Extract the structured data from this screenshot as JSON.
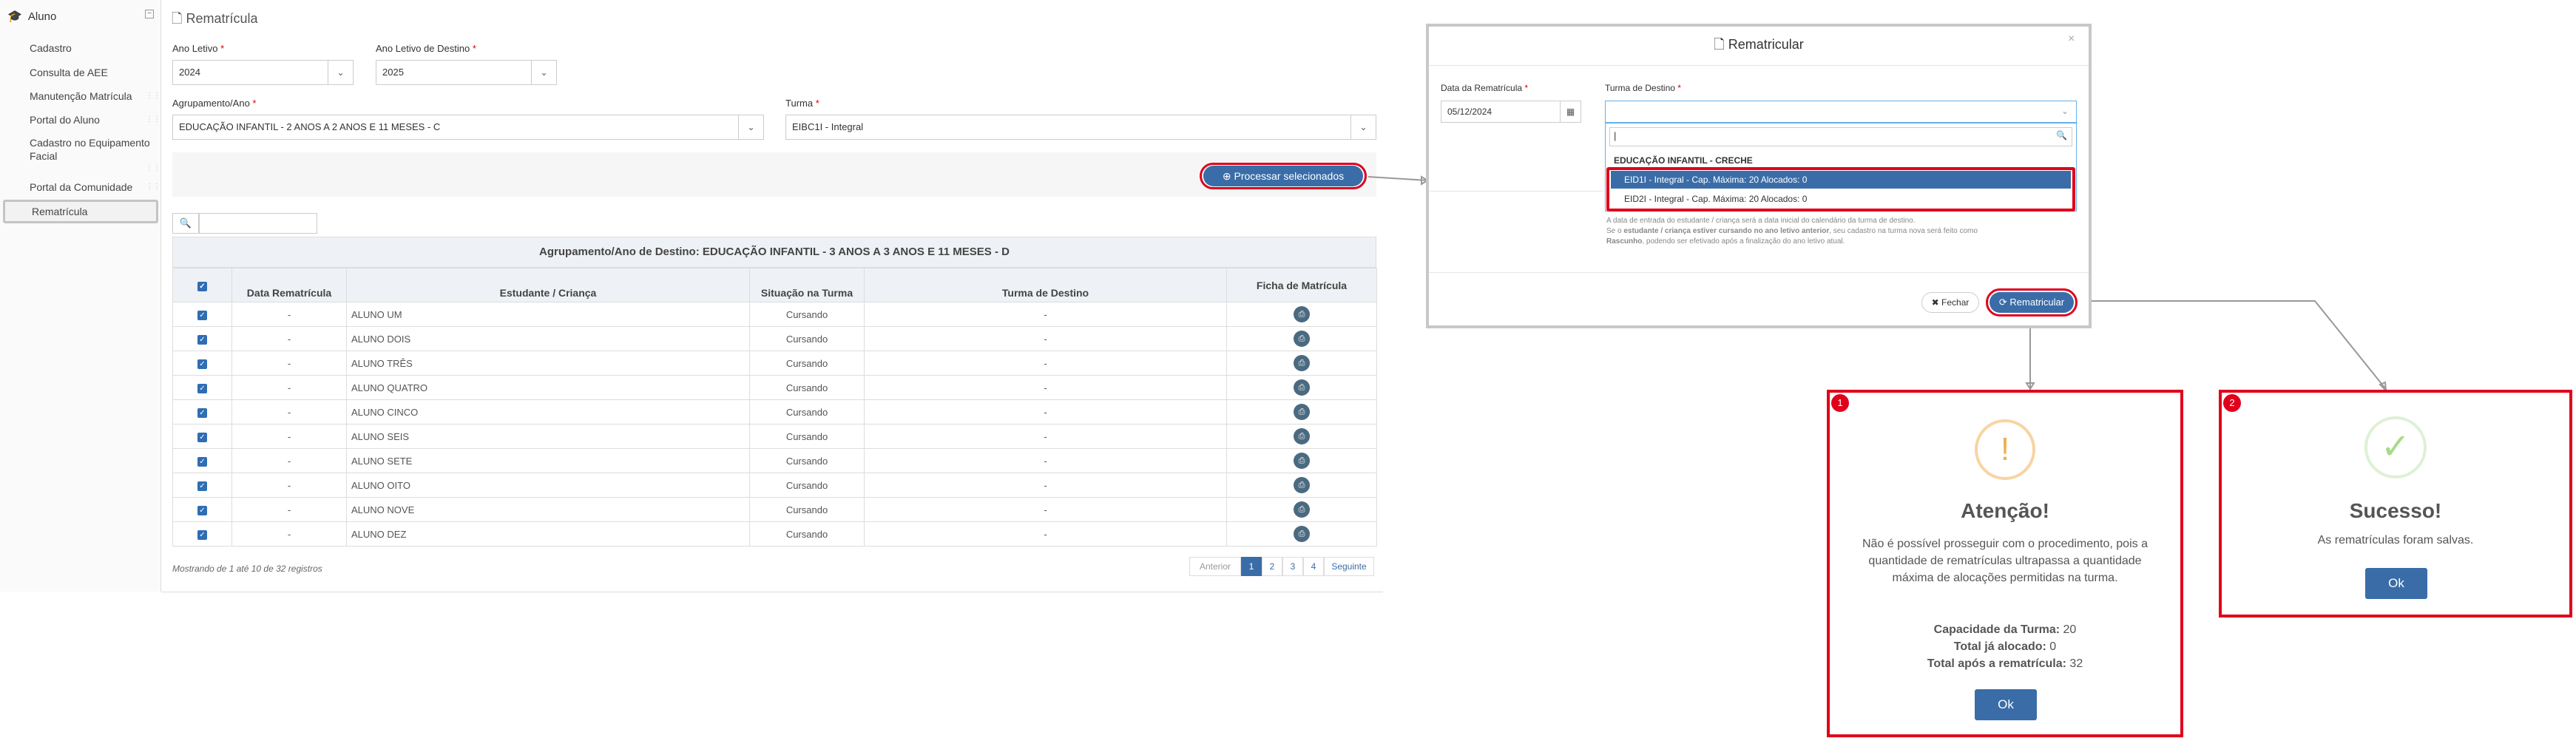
{
  "sidebar": {
    "section": "Aluno",
    "items": [
      "Cadastro",
      "Consulta de AEE",
      "Manutenção Matrícula",
      "Portal do Aluno",
      "Cadastro no Equipamento Facial",
      "Portal da Comunidade"
    ],
    "active": "Rematrícula"
  },
  "page": {
    "title": "Rematrícula",
    "ano_letivo_label": "Ano Letivo",
    "ano_letivo_value": "2024",
    "ano_destino_label": "Ano Letivo de Destino",
    "ano_destino_value": "2025",
    "agrupamento_label": "Agrupamento/Ano",
    "agrupamento_value": "EDUCAÇÃO INFANTIL - 2 ANOS A 2 ANOS E 11 MESES - C",
    "turma_label": "Turma",
    "turma_value": "EIBC1I - Integral",
    "process_button": "Processar selecionados",
    "required_mark": "*"
  },
  "table": {
    "caption": "Agrupamento/Ano de Destino: EDUCAÇÃO INFANTIL - 3 ANOS A 3 ANOS E 11 MESES - D",
    "headers": [
      "Data Rematrícula",
      "Estudante / Criança",
      "Situação na Turma",
      "Turma de Destino",
      "Ficha de Matrícula"
    ],
    "rows": [
      {
        "data": "-",
        "nome": "ALUNO UM",
        "situacao": "Cursando",
        "destino": "-"
      },
      {
        "data": "-",
        "nome": "ALUNO DOIS",
        "situacao": "Cursando",
        "destino": "-"
      },
      {
        "data": "-",
        "nome": "ALUNO TRÊS",
        "situacao": "Cursando",
        "destino": "-"
      },
      {
        "data": "-",
        "nome": "ALUNO QUATRO",
        "situacao": "Cursando",
        "destino": "-"
      },
      {
        "data": "-",
        "nome": "ALUNO CINCO",
        "situacao": "Cursando",
        "destino": "-"
      },
      {
        "data": "-",
        "nome": "ALUNO SEIS",
        "situacao": "Cursando",
        "destino": "-"
      },
      {
        "data": "-",
        "nome": "ALUNO SETE",
        "situacao": "Cursando",
        "destino": "-"
      },
      {
        "data": "-",
        "nome": "ALUNO OITO",
        "situacao": "Cursando",
        "destino": "-"
      },
      {
        "data": "-",
        "nome": "ALUNO NOVE",
        "situacao": "Cursando",
        "destino": "-"
      },
      {
        "data": "-",
        "nome": "ALUNO DEZ",
        "situacao": "Cursando",
        "destino": "-"
      }
    ],
    "footer": "Mostrando de 1 até 10 de 32 registros",
    "pagination": [
      "Anterior",
      "1",
      "2",
      "3",
      "4",
      "Seguinte"
    ]
  },
  "modal": {
    "title": "Rematricular",
    "close_x": "×",
    "data_label": "Data da Rematrícula",
    "data_value": "05/12/2024",
    "turma_label": "Turma de Destino",
    "group_label": "EDUCAÇÃO INFANTIL - CRECHE",
    "options": [
      "EID1I - Integral - Cap. Máxima: 20 Alocados: 0",
      "EID2I - Integral - Cap. Máxima: 20 Alocados: 0"
    ],
    "help_line1": "A data de entrada do estudante / criança será a data inicial do calendário da turma de destino.",
    "help_line2a": "Se o ",
    "help_line2b": "estudante / criança estiver cursando no ano letivo anterior",
    "help_line2c": ", seu cadastro na turma nova será feito como",
    "help_line3a": "Rascunho",
    "help_line3b": ", podendo ser efetivado após a finalização do ano letivo atual.",
    "fechar": "Fechar",
    "rematricular": "Rematricular"
  },
  "alert_warning": {
    "badge": "1",
    "title": "Atenção!",
    "message": "Não é possível prosseguir com o procedimento, pois a quantidade de rematrículas ultrapassa a quantidade máxima de alocações permitidas na turma.",
    "cap_label": "Capacidade da Turma:",
    "cap_value": "20",
    "alloc_label": "Total já alocado:",
    "alloc_value": "0",
    "after_label": "Total após a rematrícula:",
    "after_value": "32",
    "ok": "Ok"
  },
  "alert_success": {
    "badge": "2",
    "title": "Sucesso!",
    "message": "As rematrículas foram salvas.",
    "ok": "Ok"
  },
  "colors": {
    "accent": "#3a6da8",
    "highlight": "#e0001b",
    "warning": "#f0ad4e",
    "success": "#a5dc86"
  }
}
